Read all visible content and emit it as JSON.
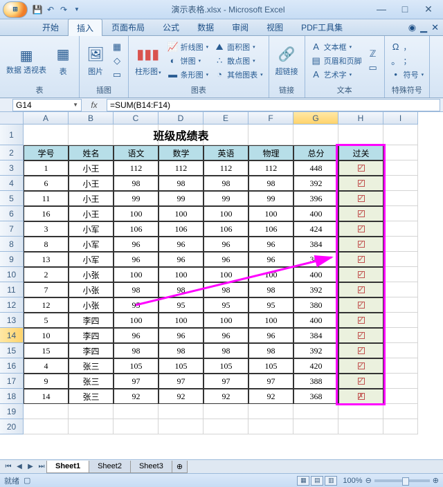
{
  "title": "演示表格.xlsx - Microsoft Excel",
  "qat": {
    "save": "💾",
    "undo": "↶",
    "redo": "↷"
  },
  "tabs": [
    "开始",
    "插入",
    "页面布局",
    "公式",
    "数据",
    "审阅",
    "视图",
    "PDF工具集"
  ],
  "active_tab": 1,
  "ribbon": {
    "g1": {
      "label": "表",
      "pivot": "数据\n透视表",
      "table": "表"
    },
    "g2": {
      "label": "插图",
      "pic": "图片",
      "clip": "▦",
      "shapes": "◇",
      "smart": "▭"
    },
    "g3": {
      "label": "图表",
      "col": "柱形图",
      "line": "折线图",
      "pie": "饼图",
      "bar": "条形图",
      "area": "面积图",
      "scatter": "散点图",
      "other": "其他图表"
    },
    "g4": {
      "label": "链接",
      "link": "超链接"
    },
    "g5": {
      "label": "文本",
      "textbox": "文本框",
      "header": "页眉和页脚",
      "wordart": "艺术字"
    },
    "g6": {
      "label": "特殊符号",
      "omega": "Ω",
      "sym": "符号"
    }
  },
  "namebox": "G14",
  "formula": "=SUM(B14:F14)",
  "colheaders": [
    "A",
    "B",
    "C",
    "D",
    "E",
    "F",
    "G",
    "H",
    "I"
  ],
  "selected_col": 6,
  "selected_row": 14,
  "table_title": "班级成绩表",
  "headers": [
    "学号",
    "姓名",
    "语文",
    "数学",
    "英语",
    "物理",
    "总分",
    "过关"
  ],
  "rows": [
    [
      "1",
      "小王",
      "112",
      "112",
      "112",
      "112",
      "448",
      "☑"
    ],
    [
      "6",
      "小王",
      "98",
      "98",
      "98",
      "98",
      "392",
      "☑"
    ],
    [
      "11",
      "小王",
      "99",
      "99",
      "99",
      "99",
      "396",
      "☑"
    ],
    [
      "16",
      "小王",
      "100",
      "100",
      "100",
      "100",
      "400",
      "☑"
    ],
    [
      "3",
      "小军",
      "106",
      "106",
      "106",
      "106",
      "424",
      "☑"
    ],
    [
      "8",
      "小军",
      "96",
      "96",
      "96",
      "96",
      "384",
      "☑"
    ],
    [
      "13",
      "小军",
      "96",
      "96",
      "96",
      "96",
      "384",
      "☑"
    ],
    [
      "2",
      "小张",
      "100",
      "100",
      "100",
      "100",
      "400",
      "☑"
    ],
    [
      "7",
      "小张",
      "98",
      "98",
      "98",
      "98",
      "392",
      "☑"
    ],
    [
      "12",
      "小张",
      "95",
      "95",
      "95",
      "95",
      "380",
      "☑"
    ],
    [
      "5",
      "李四",
      "100",
      "100",
      "100",
      "100",
      "400",
      "☑"
    ],
    [
      "10",
      "李四",
      "96",
      "96",
      "96",
      "96",
      "384",
      "☑"
    ],
    [
      "15",
      "李四",
      "98",
      "98",
      "98",
      "98",
      "392",
      "☑"
    ],
    [
      "4",
      "张三",
      "105",
      "105",
      "105",
      "105",
      "420",
      "☑"
    ],
    [
      "9",
      "张三",
      "97",
      "97",
      "97",
      "97",
      "388",
      "☑"
    ],
    [
      "14",
      "张三",
      "92",
      "92",
      "92",
      "92",
      "368",
      "☒"
    ]
  ],
  "sheets": [
    "Sheet1",
    "Sheet2",
    "Sheet3"
  ],
  "active_sheet": 0,
  "status": "就绪",
  "zoom": "100%"
}
